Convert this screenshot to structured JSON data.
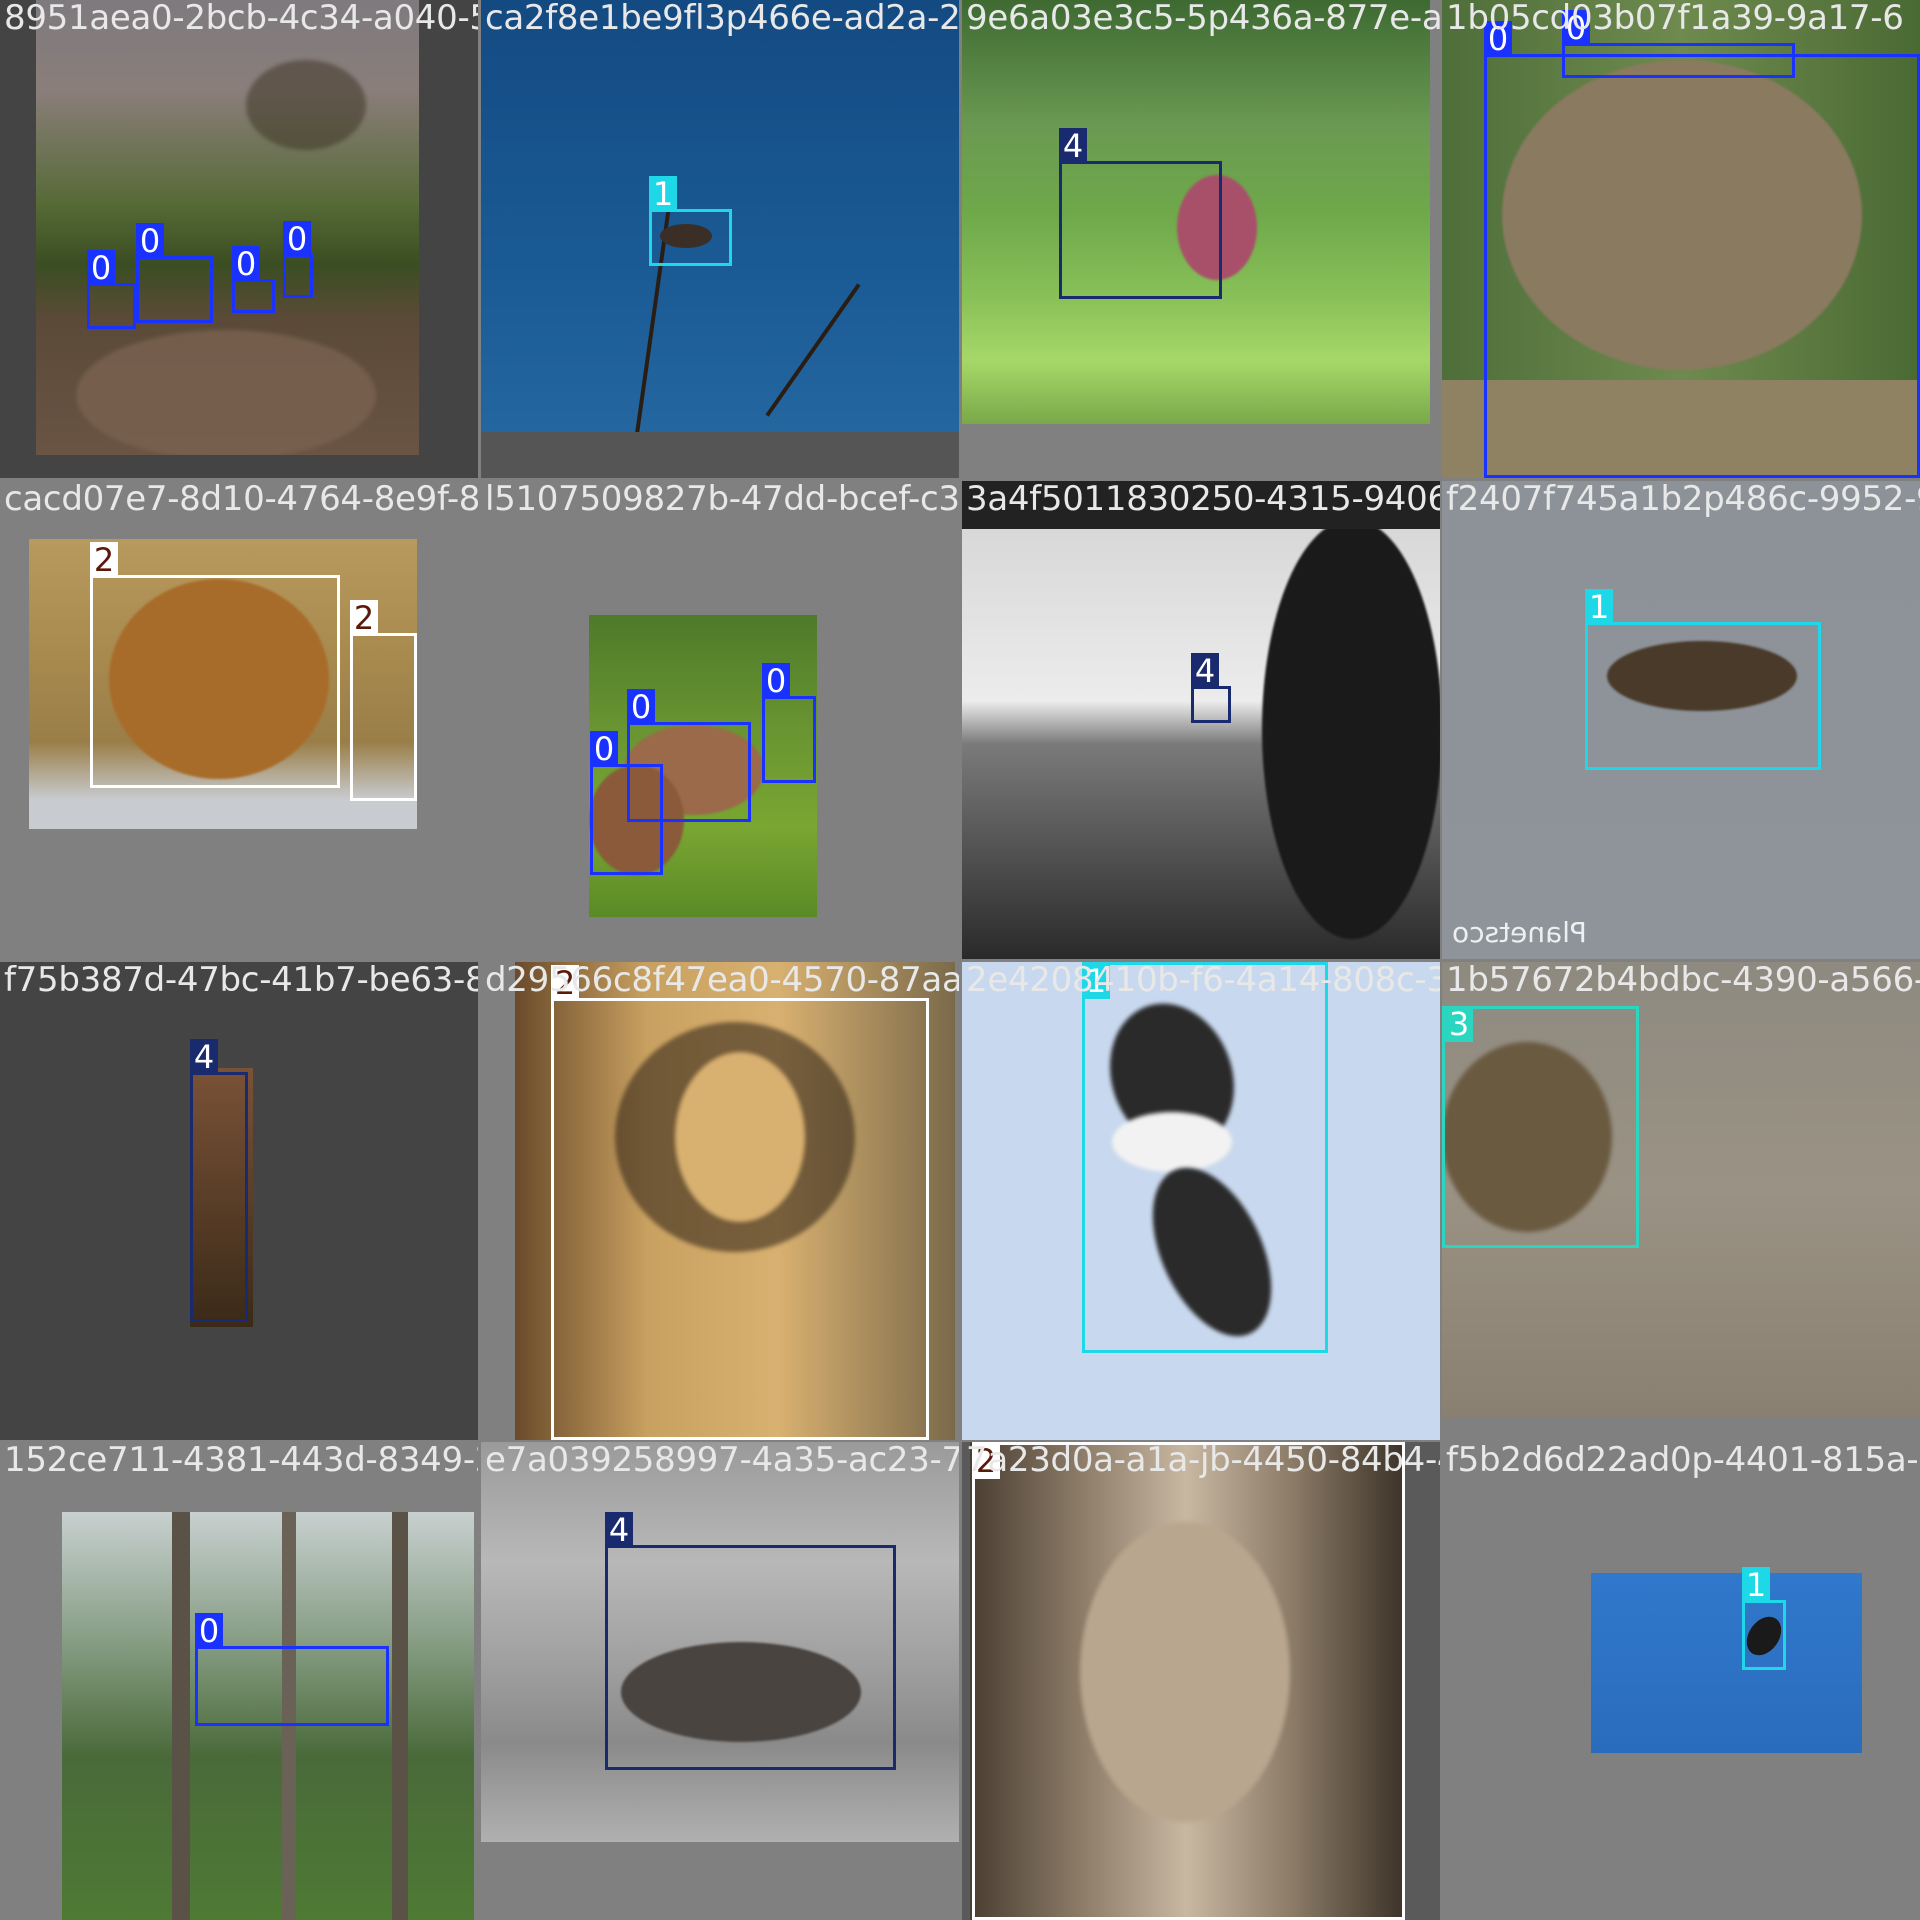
{
  "mosaic": {
    "classes": {
      "0": {
        "color": "#1a32ff"
      },
      "1": {
        "color": "#1ed8e8"
      },
      "2": {
        "color": "#ffffff",
        "label_fg": "#5a1a0a"
      },
      "3": {
        "color": "#2ad6c0"
      },
      "4": {
        "color": "#1a2a6e"
      }
    },
    "tiles": [
      {
        "filename": "8951aea0-2bcb-4c34-a040-5ba2f81bc3f1_jpg",
        "scene": "elephants-on-dirt-road",
        "detections": [
          {
            "class": "0"
          },
          {
            "class": "0"
          },
          {
            "class": "0"
          },
          {
            "class": "0"
          }
        ]
      },
      {
        "filename": "ca2f8e1be9fl3p466e-ad2a-2",
        "scene": "bird-on-bare-branch-blue-sky",
        "detections": [
          {
            "class": "1"
          }
        ]
      },
      {
        "filename": "9e6a03e3c5-5p436a-877e-a9",
        "scene": "deer-in-tall-grass",
        "detections": [
          {
            "class": "4"
          }
        ]
      },
      {
        "filename": "1b05cd03b07f1a39-9a17-6",
        "scene": "asian-elephant-close",
        "detections": [
          {
            "class": "0"
          },
          {
            "class": "0"
          }
        ]
      },
      {
        "filename": "cacd07e7-8d10-4764-8e9f-8d6137503827b_jpg",
        "scene": "resting-lions",
        "detections": [
          {
            "class": "2"
          },
          {
            "class": "2"
          }
        ]
      },
      {
        "filename": "l5107509827b-47dd-bcef-c3",
        "scene": "elephant-herd-forest",
        "detections": [
          {
            "class": "0"
          },
          {
            "class": "0"
          },
          {
            "class": "0"
          }
        ]
      },
      {
        "filename": "3a4f5011830250-4315-9406-1a",
        "scene": "deer-on-hilltop-mono",
        "detections": [
          {
            "class": "4"
          }
        ]
      },
      {
        "filename": "f2407f745a1b2p486c-9952-9",
        "scene": "eagle-flying-grey-sky",
        "watermark": "Planetsco",
        "detections": [
          {
            "class": "1"
          }
        ]
      },
      {
        "filename": "f75b387d-47bc-41b7-be63-8e2956c8f7ea0_jpg",
        "scene": "stag-narrow-crop",
        "detections": [
          {
            "class": "4"
          }
        ]
      },
      {
        "filename": "d29566c8f47ea0-4570-87aa-1",
        "scene": "lion-walking-close",
        "detections": [
          {
            "class": "2"
          }
        ]
      },
      {
        "filename": "2e4208410b-f6-4a14-808c-3",
        "scene": "sea-eagle-soaring",
        "detections": [
          {
            "class": "1"
          }
        ]
      },
      {
        "filename": "1b57672b4bdbc-4390-a566-2",
        "scene": "leopard-in-scrub",
        "detections": [
          {
            "class": "3"
          }
        ]
      },
      {
        "filename": "152ce711-4381-443d-8349-2f7e0392582b7_jpg",
        "scene": "elephant-behind-trees",
        "detections": [
          {
            "class": "0"
          }
        ]
      },
      {
        "filename": "e7a039258997-4a35-ac23-7c",
        "scene": "stag-lying-on-riverbank",
        "detections": [
          {
            "class": "4"
          }
        ]
      },
      {
        "filename": "7a23d0a-a1a-jb-4450-84b4-4",
        "scene": "lion-face-sepia",
        "detections": [
          {
            "class": "2"
          }
        ]
      },
      {
        "filename": "f5b2d6d22ad0p-4401-815a-e",
        "scene": "eagle-small-blue-sky",
        "detections": [
          {
            "class": "1"
          }
        ]
      }
    ]
  }
}
